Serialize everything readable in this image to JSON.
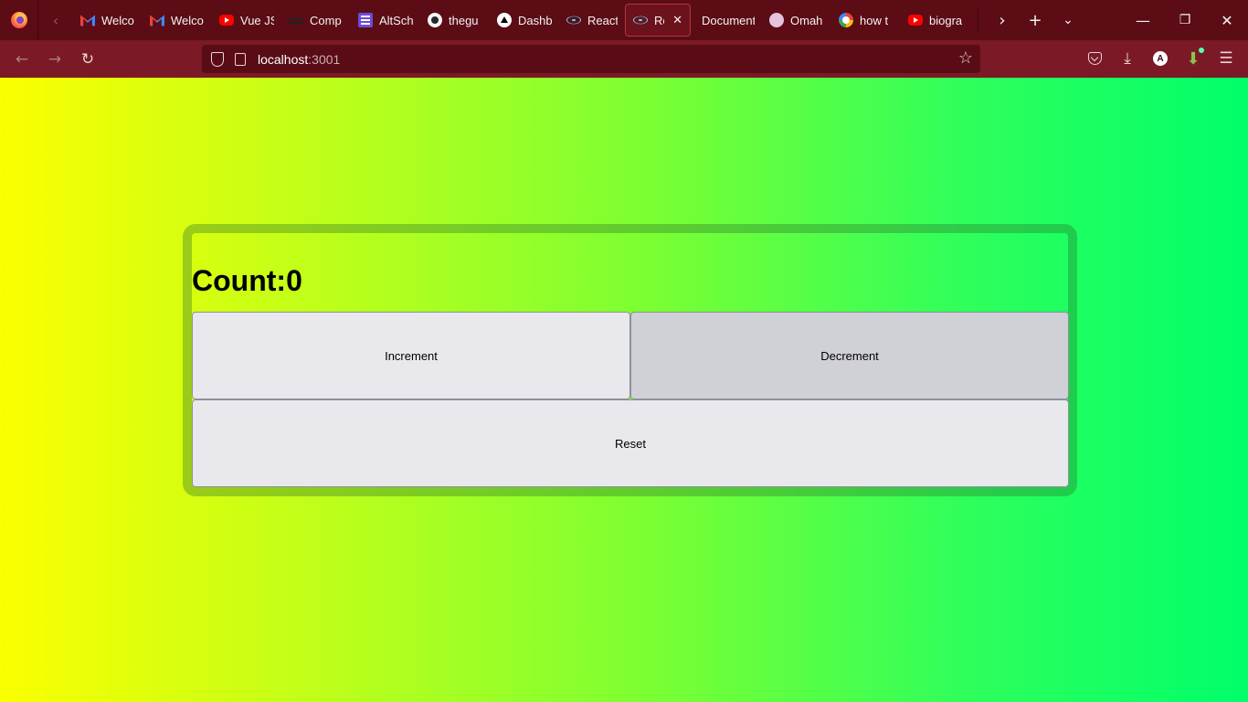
{
  "browser": {
    "tabs": [
      {
        "label": "Welco",
        "icon": "gmail-icon"
      },
      {
        "label": "Welco",
        "icon": "gmail-icon"
      },
      {
        "label": "Vue JS",
        "icon": "youtube-icon"
      },
      {
        "label": "Comp",
        "icon": "menu-lines-icon"
      },
      {
        "label": "AltSch",
        "icon": "list-icon"
      },
      {
        "label": "thegu",
        "icon": "github-icon"
      },
      {
        "label": "Dashb",
        "icon": "triangle-icon"
      },
      {
        "label": "React",
        "icon": "react-icon"
      },
      {
        "label": "Rea",
        "icon": "react-icon",
        "active": true
      },
      {
        "label": "Document",
        "icon": ""
      },
      {
        "label": "Omah",
        "icon": "xl-badge-icon"
      },
      {
        "label": "how t",
        "icon": "google-icon"
      },
      {
        "label": "biogra",
        "icon": "youtube-icon"
      }
    ],
    "address": {
      "host": "localhost",
      "port": ":3001"
    },
    "profile_initial": "A",
    "colors": {
      "tab_strip": "#5b0c15",
      "toolbar": "#7b1a26",
      "url_field": "#5a0c16",
      "active_tab_border": "#b5333f"
    }
  },
  "app": {
    "count_label": "Count:0",
    "buttons": {
      "increment": "Increment",
      "decrement": "Decrement",
      "reset": "Reset"
    },
    "colors": {
      "gradient_start": "#fbff00",
      "gradient_end": "#00ff6a",
      "button_bg": "#e9e9ed",
      "button_hover_bg": "#d0d0d7"
    }
  }
}
